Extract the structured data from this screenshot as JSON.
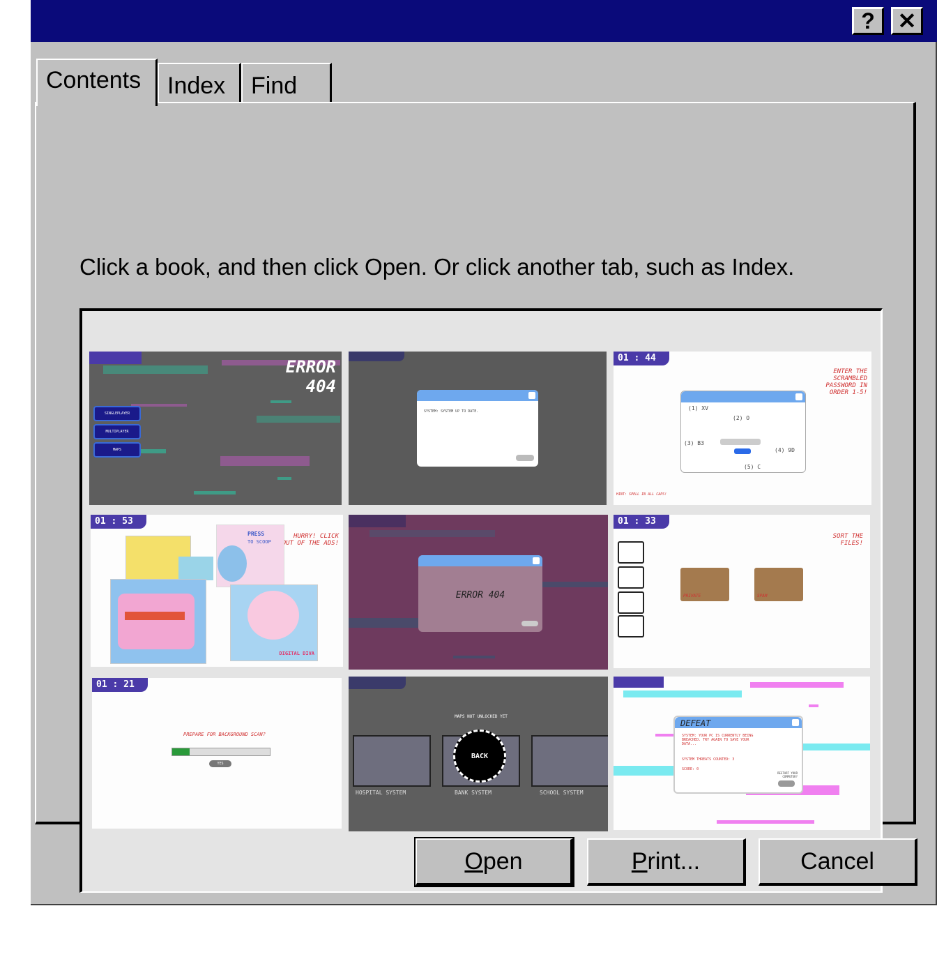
{
  "window": {
    "help_button": "?",
    "close_button": "✕"
  },
  "tabs": [
    {
      "label": "Contents"
    },
    {
      "label": "Index"
    },
    {
      "label": "Find"
    }
  ],
  "instruction": "Click a book, and then click Open. Or click another tab, such as Index.",
  "thumbnails": {
    "error_menu": {
      "title": "ERROR",
      "subtitle": "404",
      "menu": [
        "SINGLEPLAYER",
        "MULTIPLAYER",
        "MAPS"
      ]
    },
    "system_ok": {
      "message": "SYSTEM: SYSTEM UP TO DATE."
    },
    "password": {
      "timer": "01 : 44",
      "prompt": "ENTER THE SCRAMBLED PASSWORD IN ORDER 1-5!",
      "items": [
        "(1) XV",
        "(2) O",
        "(3) B3",
        "(4) 9D",
        "(5) C"
      ],
      "hint": "HINT: SPELL IN ALL CAPS!"
    },
    "ads": {
      "timer": "01 : 53",
      "prompt": "HURRY! CLICK OUT OF THE ADS!",
      "ad_text": [
        "PRESS",
        "TO SCOOP",
        "DIGITAL DIVA"
      ]
    },
    "error_popup": {
      "message": "ERROR 404"
    },
    "sort_files": {
      "timer": "01 : 33",
      "prompt": "SORT THE FILES!",
      "folders": [
        "PRIVATE",
        "SPAM"
      ]
    },
    "scan": {
      "timer": "01 : 21",
      "prompt": "PREPARE FOR BACKGROUND SCAN?",
      "button": "YES",
      "progress": 0.18
    },
    "maps": {
      "notice": "MAPS NOT UNLOCKED YET",
      "back": "BACK",
      "systems": [
        "HOSPITAL SYSTEM",
        "BANK SYSTEM",
        "SCHOOL SYSTEM"
      ]
    },
    "defeat": {
      "title": "DEFEAT",
      "body": "SYSTEM: YOUR PC IS CURRENTLY BEING BREACHED. TRY AGAIN TO SAVE YOUR DATA...",
      "threats": "SYSTEM THREATS COUNTED: 3",
      "score": "SCORE: 0",
      "restart": "RESTART YOUR COMPUTER?"
    }
  },
  "buttons": {
    "open_mnemonic": "O",
    "open_rest": "pen",
    "print_mnemonic": "P",
    "print_rest": "rint...",
    "cancel": "Cancel"
  },
  "colors": {
    "title_bar": "#0a0a7a",
    "dialog_face": "#c0c0c0",
    "list_bg": "#e4e4e4"
  }
}
